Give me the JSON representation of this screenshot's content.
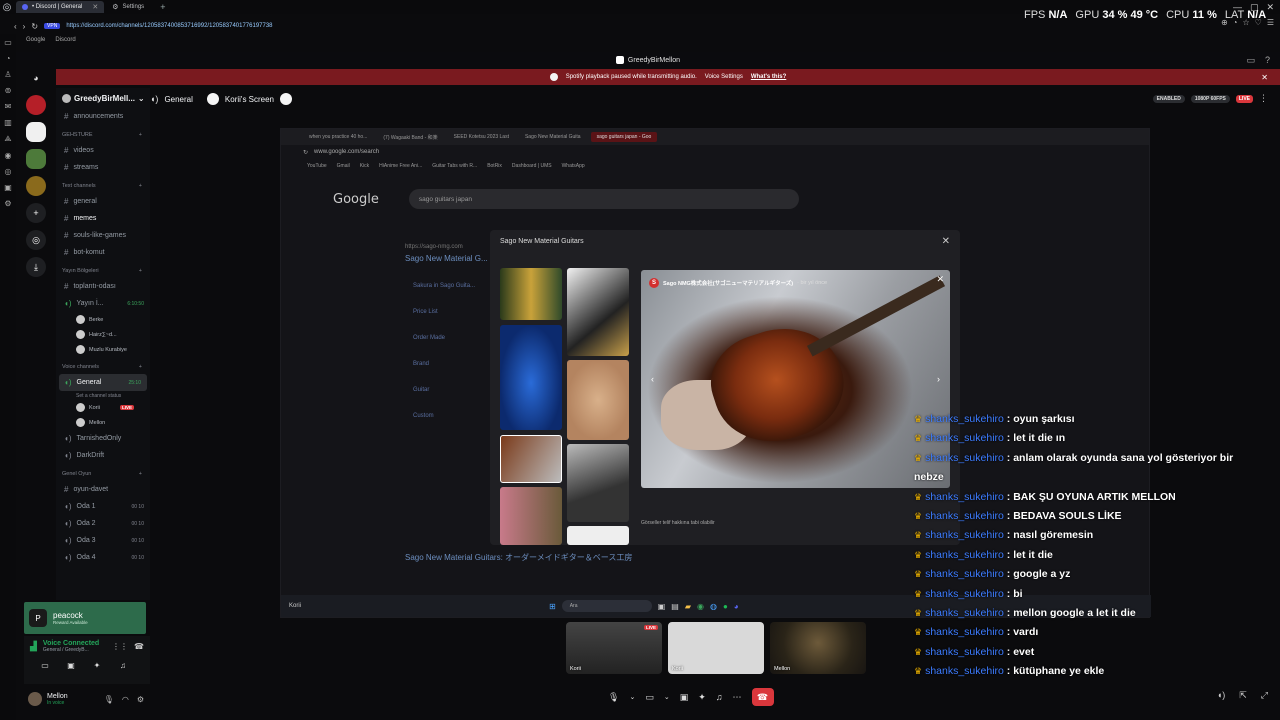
{
  "browser": {
    "tabs": [
      {
        "label": "• Discord | General",
        "active": true
      },
      {
        "label": "Settings",
        "active": false
      }
    ],
    "url": "https://discord.com/channels/1205837400853716992/1205837401776197738",
    "bookmarks": [
      "Google",
      "Discord"
    ]
  },
  "overlay_stats": {
    "fps_label": "FPS",
    "fps_value": "N/A",
    "gpu_label": "GPU",
    "gpu_value": "34 % 49 °C",
    "cpu_label": "CPU",
    "cpu_value": "11 %",
    "lat_label": "LAT",
    "lat_value": "N/A"
  },
  "discord": {
    "window_title": "GreedyBirMellon",
    "notice": {
      "text": "Spotify playback paused while transmitting audio.",
      "button": "Voice Settings",
      "link": "What's this?"
    },
    "server_name": "GreedyBirMell...",
    "channels": {
      "top": [
        "announcements"
      ],
      "cat_gehsture": "GEHSTURE",
      "gehsture": [
        "videos",
        "streams"
      ],
      "cat_text": "Text channels",
      "text": [
        "general",
        "memes",
        "souls-like-games",
        "bot-komut"
      ],
      "cat_yayin": "Yayın Bölgeleri",
      "yayin_text": "toplantı-odası",
      "yayin_voice": "Yayın İ...",
      "yayin_time": "6:10:50",
      "yayin_users": [
        "Berke",
        "Hairz∑~d...",
        "Muzlu Kurabiye"
      ],
      "cat_voice": "Voice channels",
      "general_voice": "General",
      "general_time": "25:10",
      "general_status": "Set a channel status",
      "general_users": [
        {
          "name": "Korii",
          "live": "LIVE"
        },
        {
          "name": "Mellon",
          "live": ""
        }
      ],
      "other_voice": [
        "TarnishedOnly",
        "DarkDrift"
      ],
      "cat_genel": "Genel Oyun",
      "genel_text": "oyun-davet",
      "rooms": [
        {
          "name": "Oda 1",
          "count": "00 10"
        },
        {
          "name": "Oda 2",
          "count": "00 10"
        },
        {
          "name": "Oda 3",
          "count": "00 10"
        },
        {
          "name": "Oda 4",
          "count": "00 10"
        }
      ]
    },
    "peacock": {
      "title": "peacock",
      "sub": "Reward Available"
    },
    "voice_connected": {
      "title": "Voice Connected",
      "sub": "General / GreedyB..."
    },
    "user": {
      "name": "Mellon",
      "status": "In voice"
    },
    "header": {
      "channel": "General",
      "screen": "Korii's Screen",
      "enabled": "ENABLED",
      "quality": "1080P 60FPS",
      "live": "LIVE"
    },
    "chat": [
      {
        "user": "shanks_sukehiro",
        "text": "oyun şarkısı"
      },
      {
        "user": "shanks_sukehiro",
        "text": "let it die ın"
      },
      {
        "user": "shanks_sukehiro",
        "text": "anlam olarak oyunda sana yol gösteriyor bir nebze"
      },
      {
        "user": "shanks_sukehiro",
        "text": "BAK ŞU OYUNA ARTIK MELLON"
      },
      {
        "user": "shanks_sukehiro",
        "text": "BEDAVA SOULS LİKE"
      },
      {
        "user": "shanks_sukehiro",
        "text": "nasıl göremesin"
      },
      {
        "user": "shanks_sukehiro",
        "text": "let it die"
      },
      {
        "user": "shanks_sukehiro",
        "text": "google a yz"
      },
      {
        "user": "shanks_sukehiro",
        "text": "bi"
      },
      {
        "user": "shanks_sukehiro",
        "text": "mellon google a let it die"
      },
      {
        "user": "shanks_sukehiro",
        "text": "vardı"
      },
      {
        "user": "shanks_sukehiro",
        "text": "evet"
      },
      {
        "user": "shanks_sukehiro",
        "text": "kütüphane ye ekle"
      }
    ],
    "tiles": [
      {
        "name": "Korii",
        "live": "LIVE"
      },
      {
        "name": "Korii",
        "live": ""
      },
      {
        "name": "Mellon",
        "live": ""
      }
    ]
  },
  "stream": {
    "tabs": [
      "when you practice 40 ho...",
      "(7) Wagaaki Band - 和楽",
      "SEED Kotetsu 2023 Last",
      "Sago New Material Guita",
      "sago guitars japan - Goo"
    ],
    "url": "www.google.com/search",
    "bookmarks": [
      "YouTube",
      "Gmail",
      "Kick",
      "HiAnime Free Ani...",
      "Guitar Tabs with R...",
      "BotRix",
      "Dashboard | UMS",
      "WhatsApp"
    ],
    "google": "Google",
    "query": "sago guitars japan",
    "result_title": "Sago New Material G...",
    "result_sub": "https://sago-nmg.com",
    "side_links": [
      "Sakura in Sago Guita...",
      "Price List",
      "Order Made",
      "Brand",
      "Guitar",
      "Custom"
    ],
    "bottom_result": "Sago New Material Guitars: オーダーメイドギター＆ベース工房",
    "dialog_title": "Sago New Material Guitars",
    "image_source": "Sago NMG株式会社(サゴニューマテリアルギターズ)",
    "image_source_extra": "· bir yıl önce",
    "copyright": "Görseller telif hakkına tabi olabilir",
    "taskbar_user": "Korii",
    "taskbar_search": "Ara"
  }
}
